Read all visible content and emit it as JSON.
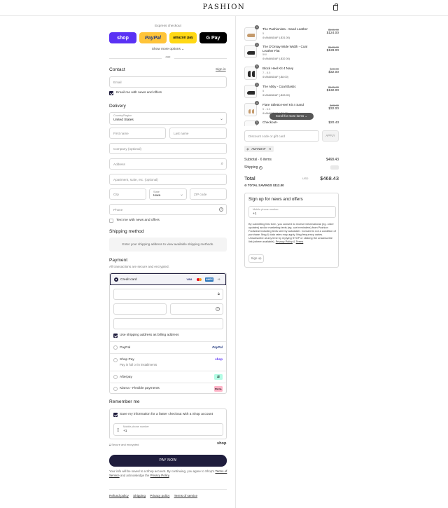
{
  "header": {
    "logo": "PASHION"
  },
  "express": {
    "title": "Express checkout",
    "buttons": {
      "shop": "shop",
      "paypal": "PayPal",
      "amazon": "amazon pay",
      "gpay": "G Pay"
    },
    "show_more": "Show more options ⌄",
    "or": "OR"
  },
  "contact": {
    "heading": "Contact",
    "sign_in": "Sign in",
    "email_placeholder": "Email",
    "email_news": "Email me with news and offers"
  },
  "delivery": {
    "heading": "Delivery",
    "country_label": "Country/Region",
    "country": "United States",
    "first_name": "First name",
    "last_name": "Last name",
    "company": "Company (optional)",
    "address": "Address",
    "apartment": "Apartment, suite, etc. (optional)",
    "city": "City",
    "state_label": "State",
    "state": "Iowa",
    "zip": "ZIP code",
    "phone": "Phone",
    "text_news": "Text me with news and offers"
  },
  "shipping_method": {
    "heading": "Shipping method",
    "placeholder": "Enter your shipping address to view available shipping methods."
  },
  "payment": {
    "heading": "Payment",
    "subtitle": "All transactions are secure and encrypted.",
    "credit_card": "Credit card",
    "cards": {
      "visa": "VISA",
      "amex": "AMEX",
      "more": "+5"
    },
    "billing_same": "Use shipping address as billing address",
    "paypal": "PayPal",
    "paypal_logo": "PayPal",
    "shop_pay": "Shop Pay",
    "shop_pay_sub": "Pay in full or in installments",
    "shop_logo": "shop",
    "afterpay": "Afterpay",
    "klarna": "Klarna - Flexible payments",
    "klarna_logo": "Klarna."
  },
  "remember": {
    "heading": "Remember me",
    "save_info": "Save my information for a faster checkout with a Shop account",
    "mobile_label": "Mobile phone number",
    "mobile_value": "+1",
    "secure": "Secure and encrypted",
    "shop_logo": "shop"
  },
  "pay_now": "PAY NOW",
  "legal": {
    "pre": "Your info will be saved to a Shop account. By continuing, you agree to Shop's",
    "terms": "Terms of Service",
    "mid": "and acknowledge the",
    "privacy": "Privacy Policy",
    "end": "."
  },
  "footer": [
    "Refund policy",
    "Shipping",
    "Privacy policy",
    "Terms of service"
  ],
  "cart": {
    "items": [
      {
        "qty": "1",
        "name": "The Pashionista - Sand Leather",
        "variant": "5",
        "discount": "AMANDAF (-$31.00)",
        "old": "$155.00",
        "price": "$124.00"
      },
      {
        "qty": "1",
        "name": "The D'Orsay Wide Width - Coal Leather Flat",
        "variant": "5W",
        "discount": "AMANDAF (-$32.00)",
        "old": "$160.00",
        "price": "$128.00"
      },
      {
        "qty": "1",
        "name": "Block Heel Kit 4 Navy",
        "variant": "7 - 8.5",
        "discount": "AMANDAF (-$8.00)",
        "old": "$40.00",
        "price": "$32.00"
      },
      {
        "qty": "1",
        "name": "The Abby - Coal Elastic",
        "variant": "5",
        "discount": "AMANDAF (-$33.00)",
        "old": "$165.00",
        "price": "$132.00"
      },
      {
        "qty": "1",
        "name": "Flare Stiletto Heel Kit 4 Sand",
        "variant": "5 - 6.5",
        "discount": "AMANDAF (-$8.00)",
        "old": "$40.00",
        "price": "$32.00"
      },
      {
        "qty": "1",
        "name": "Checkout+",
        "variant": "",
        "discount": "",
        "old": "",
        "price": "$20.43"
      }
    ],
    "scroll_hint": "Scroll for more items ⌄",
    "discount_placeholder": "Discount code or gift card",
    "apply": "APPLY",
    "applied_code": "AMANDAF",
    "subtotal_label": "Subtotal · 6 items",
    "subtotal": "$468.43",
    "shipping_label": "Shipping",
    "total_label": "Total",
    "currency": "USD",
    "total": "$468.43",
    "savings_label": "TOTAL SAVINGS",
    "savings": "$112.00"
  },
  "signup": {
    "heading": "Sign up for news and offers",
    "mobile_label": "Mobile phone number",
    "mobile_value": "+1",
    "consent": "By submitting this form, you consent to receive informational (eg. order updates) and/or marketing texts (eg. cart reminders) from Pashion Footwear including texts sent by autodialer. Consent is not a condition of purchase. Msg & data rates may apply. Msg frequency varies. Unsubscribe at any time by replying STOP or clicking the unsubscribe link (where available).",
    "privacy": "Privacy Policy",
    "amp": "&",
    "terms": "Terms",
    "button": "Sign up"
  }
}
